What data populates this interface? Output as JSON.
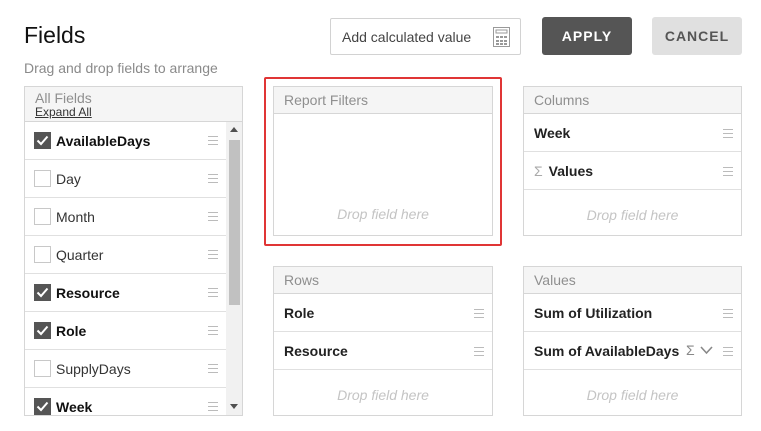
{
  "header": {
    "title": "Fields",
    "subtitle": "Drag and drop fields to arrange",
    "calc_label": "Add calculated value",
    "apply_label": "APPLY",
    "cancel_label": "CANCEL"
  },
  "all_fields": {
    "title": "All Fields",
    "expand_label": "Expand All",
    "items": [
      {
        "label": "AvailableDays",
        "checked": true
      },
      {
        "label": "Day",
        "checked": false
      },
      {
        "label": "Month",
        "checked": false
      },
      {
        "label": "Quarter",
        "checked": false
      },
      {
        "label": "Resource",
        "checked": true
      },
      {
        "label": "Role",
        "checked": true
      },
      {
        "label": "SupplyDays",
        "checked": false
      },
      {
        "label": "Week",
        "checked": true
      }
    ]
  },
  "report_filters": {
    "title": "Report Filters",
    "drop_text": "Drop field here"
  },
  "columns": {
    "title": "Columns",
    "items": [
      "Week",
      "Values"
    ],
    "drop_text": "Drop field here"
  },
  "rows": {
    "title": "Rows",
    "items": [
      "Role",
      "Resource"
    ],
    "drop_text": "Drop field here"
  },
  "values": {
    "title": "Values",
    "items": [
      "Sum of Utilization",
      "Sum of AvailableDays"
    ],
    "drop_text": "Drop field here"
  },
  "colors": {
    "primary_button": "#555555",
    "secondary_button": "#e0e0e0",
    "highlight": "#e03535"
  }
}
